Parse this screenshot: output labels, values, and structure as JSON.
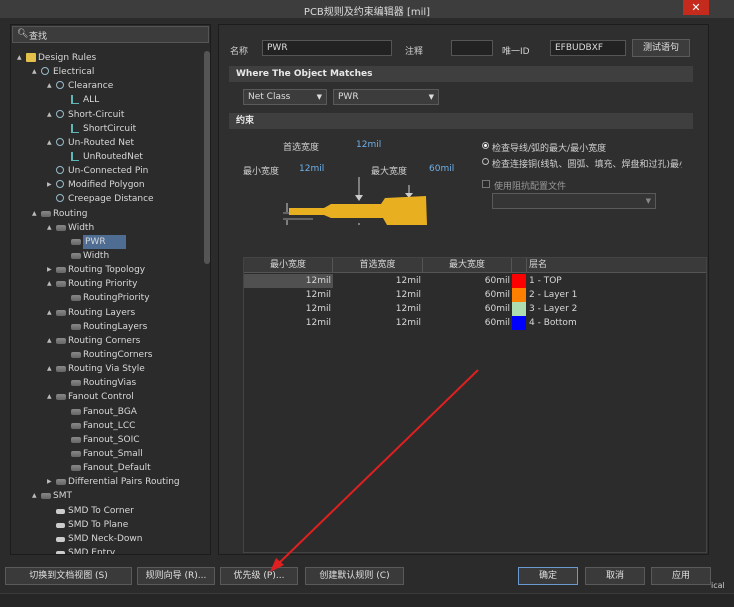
{
  "window": {
    "title": "PCB规则及约束编辑器 [mil]",
    "close_glyph": "✕"
  },
  "search": {
    "label": "查找"
  },
  "tree": [
    {
      "label": "Design Rules",
      "level": 0,
      "icon": "folder-icon",
      "arrow": "▲"
    },
    {
      "label": "Electrical",
      "level": 1,
      "icon": "rule-icon",
      "arrow": "▲"
    },
    {
      "label": "Clearance",
      "level": 2,
      "icon": "rule-icon",
      "arrow": "▲"
    },
    {
      "label": "ALL",
      "level": 3,
      "icon": "leaf-icon",
      "arrow": ""
    },
    {
      "label": "Short-Circuit",
      "level": 2,
      "icon": "rule-icon",
      "arrow": "▲"
    },
    {
      "label": "ShortCircuit",
      "level": 3,
      "icon": "leaf-icon",
      "arrow": ""
    },
    {
      "label": "Un-Routed Net",
      "level": 2,
      "icon": "rule-icon",
      "arrow": "▲"
    },
    {
      "label": "UnRoutedNet",
      "level": 3,
      "icon": "leaf-icon",
      "arrow": ""
    },
    {
      "label": "Un-Connected Pin",
      "level": 2,
      "icon": "rule-icon",
      "arrow": ""
    },
    {
      "label": "Modified Polygon",
      "level": 2,
      "icon": "rule-icon",
      "arrow": "▶"
    },
    {
      "label": "Creepage Distance",
      "level": 2,
      "icon": "rule-icon",
      "arrow": ""
    },
    {
      "label": "Routing",
      "level": 1,
      "icon": "category-icon",
      "arrow": "▲"
    },
    {
      "label": "Width",
      "level": 2,
      "icon": "category-icon",
      "arrow": "▲"
    },
    {
      "label": "PWR",
      "level": 3,
      "icon": "category-icon",
      "arrow": "",
      "selected": true
    },
    {
      "label": "Width",
      "level": 3,
      "icon": "category-icon",
      "arrow": ""
    },
    {
      "label": "Routing Topology",
      "level": 2,
      "icon": "category-icon",
      "arrow": "▶"
    },
    {
      "label": "Routing Priority",
      "level": 2,
      "icon": "category-icon",
      "arrow": "▲"
    },
    {
      "label": "RoutingPriority",
      "level": 3,
      "icon": "category-icon",
      "arrow": ""
    },
    {
      "label": "Routing Layers",
      "level": 2,
      "icon": "category-icon",
      "arrow": "▲"
    },
    {
      "label": "RoutingLayers",
      "level": 3,
      "icon": "category-icon",
      "arrow": ""
    },
    {
      "label": "Routing Corners",
      "level": 2,
      "icon": "category-icon",
      "arrow": "▲"
    },
    {
      "label": "RoutingCorners",
      "level": 3,
      "icon": "category-icon",
      "arrow": ""
    },
    {
      "label": "Routing Via Style",
      "level": 2,
      "icon": "category-icon",
      "arrow": "▲"
    },
    {
      "label": "RoutingVias",
      "level": 3,
      "icon": "category-icon",
      "arrow": ""
    },
    {
      "label": "Fanout Control",
      "level": 2,
      "icon": "category-icon",
      "arrow": "▲"
    },
    {
      "label": "Fanout_BGA",
      "level": 3,
      "icon": "category-icon",
      "arrow": ""
    },
    {
      "label": "Fanout_LCC",
      "level": 3,
      "icon": "category-icon",
      "arrow": ""
    },
    {
      "label": "Fanout_SOIC",
      "level": 3,
      "icon": "category-icon",
      "arrow": ""
    },
    {
      "label": "Fanout_Small",
      "level": 3,
      "icon": "category-icon",
      "arrow": ""
    },
    {
      "label": "Fanout_Default",
      "level": 3,
      "icon": "category-icon",
      "arrow": ""
    },
    {
      "label": "Differential Pairs Routing",
      "level": 2,
      "icon": "category-icon",
      "arrow": "▶"
    },
    {
      "label": "SMT",
      "level": 1,
      "icon": "category-icon",
      "arrow": "▲"
    },
    {
      "label": "SMD To Corner",
      "level": 2,
      "icon": "smt-icon",
      "arrow": ""
    },
    {
      "label": "SMD To Plane",
      "level": 2,
      "icon": "smt-icon",
      "arrow": ""
    },
    {
      "label": "SMD Neck-Down",
      "level": 2,
      "icon": "smt-icon",
      "arrow": ""
    },
    {
      "label": "SMD Entry",
      "level": 2,
      "icon": "smt-icon",
      "arrow": ""
    }
  ],
  "rule": {
    "name_label": "名称",
    "name_value": "PWR",
    "comment_label": "注释",
    "comment_value": "",
    "uid_label": "唯一ID",
    "uid_value": "EFBUDBXF",
    "test_button": "测试语句"
  },
  "match": {
    "header": "Where The Object Matches",
    "type_value": "Net Class",
    "class_value": "PWR",
    "caret": "▼"
  },
  "constraints": {
    "header": "约束",
    "preferred_label": "首选宽度",
    "preferred_value": "12mil",
    "min_label": "最小宽度",
    "min_value": "12mil",
    "max_label": "最大宽度",
    "max_value": "60mil",
    "radio1": "检查导线/弧的最大/最小宽度",
    "radio2": "检查连接铜(线轨、圆弧、填充、焊盘和过孔)最小",
    "impedance_label": "使用阻抗配置文件",
    "impedance_caret": "▼"
  },
  "table": {
    "headers": [
      "最小宽度",
      "首选宽度",
      "最大宽度",
      "",
      "层名"
    ],
    "rows": [
      {
        "min": "12mil",
        "pref": "12mil",
        "max": "60mil",
        "color": "#ff0000",
        "layer": "1 - TOP"
      },
      {
        "min": "12mil",
        "pref": "12mil",
        "max": "60mil",
        "color": "#ff8000",
        "layer": "2 - Layer 1"
      },
      {
        "min": "12mil",
        "pref": "12mil",
        "max": "60mil",
        "color": "#aedeb0",
        "layer": "3 - Layer 2"
      },
      {
        "min": "12mil",
        "pref": "12mil",
        "max": "60mil",
        "color": "#0000ff",
        "layer": "4 - Bottom"
      }
    ]
  },
  "footer": {
    "switch_view": "切换到文档视图 (S)",
    "rule_wizard": "规则向导 (R)...",
    "priority": "优先级 (P)...",
    "create_default": "创建默认规则 (C)",
    "ok": "确定",
    "cancel": "取消",
    "apply": "应用",
    "edge_text": "ical"
  },
  "colors": {
    "accent": "#4f6d92",
    "trace": "#e8b020",
    "arrow": "#e02020"
  }
}
